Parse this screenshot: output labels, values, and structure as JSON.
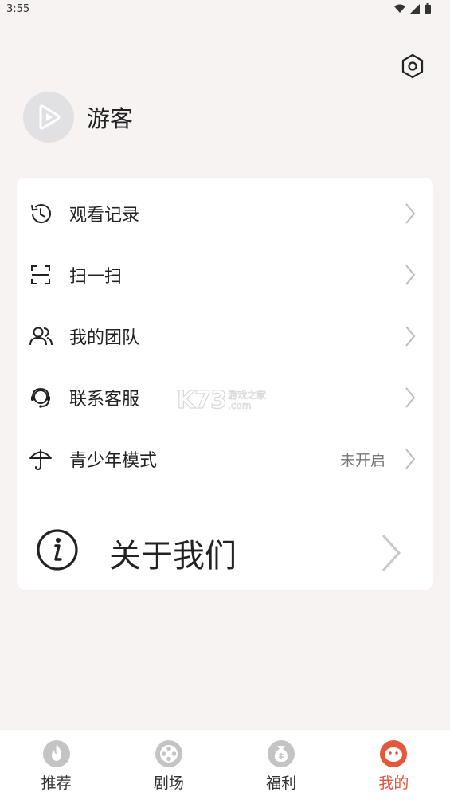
{
  "status_bar": {
    "time": "3:55"
  },
  "profile": {
    "username": "游客"
  },
  "menu": [
    {
      "id": "history",
      "label": "观看记录",
      "icon": "history-icon",
      "value": ""
    },
    {
      "id": "scan",
      "label": "扫一扫",
      "icon": "scan-icon",
      "value": ""
    },
    {
      "id": "team",
      "label": "我的团队",
      "icon": "team-icon",
      "value": ""
    },
    {
      "id": "support",
      "label": "联系客服",
      "icon": "headset-icon",
      "value": ""
    },
    {
      "id": "teen_mode",
      "label": "青少年模式",
      "icon": "umbrella-icon",
      "value": "未开启"
    }
  ],
  "about": {
    "label": "关于我们",
    "icon": "info-icon"
  },
  "watermark": {
    "brand": "K73",
    "line1": "游戏之家",
    "line2": ".com"
  },
  "tabs": [
    {
      "label": "推荐",
      "icon": "flame-icon",
      "active": false
    },
    {
      "label": "剧场",
      "icon": "film-reel-icon",
      "active": false
    },
    {
      "label": "福利",
      "icon": "money-bag-icon",
      "active": false
    },
    {
      "label": "我的",
      "icon": "face-icon",
      "active": true
    }
  ],
  "colors": {
    "accent": "#e5563b",
    "background": "#f6f3f2",
    "card": "#ffffff",
    "inactive_icon": "#c4c4c4"
  }
}
